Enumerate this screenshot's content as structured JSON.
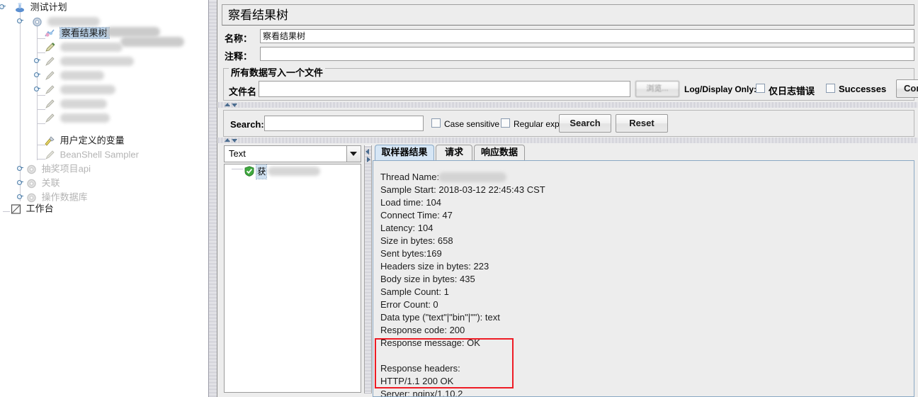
{
  "tree": {
    "nodes": [
      {
        "label": "测试计划",
        "icon": "test-plan-icon",
        "blurred": false,
        "selected": false,
        "depth": 0
      },
      {
        "label": "",
        "icon": "thread-group-icon",
        "blurred": true,
        "blur_width": 74,
        "selected": false,
        "depth": 1
      },
      {
        "label": "察看结果树",
        "icon": "view-results-tree-icon",
        "blurred": false,
        "selected": true,
        "depth": 2
      },
      {
        "label": "",
        "icon": "pencil-icon",
        "blurred": true,
        "blur_width": 88,
        "selected": false,
        "depth": 2
      },
      {
        "label": "",
        "icon": "sampler-icon",
        "blurred": true,
        "blur_width": 104,
        "selected": false,
        "depth": 2
      },
      {
        "label": "",
        "icon": "sampler-icon",
        "blurred": true,
        "blur_width": 62,
        "selected": false,
        "depth": 2
      },
      {
        "label": "",
        "icon": "sampler-icon",
        "blurred": true,
        "blur_width": 78,
        "selected": false,
        "depth": 2
      },
      {
        "label": "",
        "icon": "sampler-icon",
        "blurred": true,
        "blur_width": 66,
        "selected": false,
        "depth": 2
      },
      {
        "label": "用户定义的变量",
        "icon": "user-defined-variables-icon",
        "blurred": false,
        "selected": false,
        "depth": 2
      },
      {
        "label": "BeanShell Sampler",
        "icon": "beanshell-icon",
        "blurred": false,
        "selected": false,
        "depth": 2,
        "dim": true
      },
      {
        "label": "抽奖项目api",
        "icon": "thread-group-icon",
        "blurred": false,
        "selected": false,
        "depth": 1,
        "dim": true
      },
      {
        "label": "关联",
        "icon": "thread-group-icon",
        "blurred": false,
        "selected": false,
        "depth": 1,
        "dim": true
      },
      {
        "label": "操作数据库",
        "icon": "thread-group-icon",
        "blurred": false,
        "selected": false,
        "depth": 1,
        "dim": true
      },
      {
        "label": "工作台",
        "icon": "workbench-icon",
        "blurred": false,
        "selected": false,
        "depth": 0
      }
    ]
  },
  "panel": {
    "title": "察看结果树",
    "name_label": "名称：",
    "name_value": "察看结果树",
    "comment_label": "注释：",
    "comment_value": "",
    "filegroup_title": "所有数据写入一个文件",
    "filename_label": "文件名",
    "filename_value": "",
    "filename_placeholder": "",
    "browse_button": "浏览...",
    "log_display_only_label": "Log/Display Only:",
    "errors_only_checkbox": "仅日志错误",
    "errors_only_checked": false,
    "successes_checkbox": "Successes",
    "successes_checked": false,
    "configure_button": "Confi"
  },
  "search": {
    "label": "Search:",
    "value": "",
    "case_sensitive_label": "Case sensitive",
    "case_sensitive_checked": false,
    "regular_exp_label": "Regular exp.",
    "regular_exp_checked": false,
    "search_button": "Search",
    "reset_button": "Reset"
  },
  "results": {
    "renderer_selected": "Text",
    "renderer_options": [
      "Text"
    ],
    "tree_item_label": "获",
    "tabs": [
      {
        "label": "取样器结果",
        "active": true
      },
      {
        "label": "请求",
        "active": false
      },
      {
        "label": "响应数据",
        "active": false
      }
    ],
    "detail_lines": [
      "Thread Name:",
      "Sample Start: 2018-03-12 22:45:43 CST",
      "Load time: 104",
      "Connect Time: 47",
      "Latency: 104",
      "Size in bytes: 658",
      "Sent bytes:169",
      "Headers size in bytes: 223",
      "Body size in bytes: 435",
      "Sample Count: 1",
      "Error Count: 0",
      "Data type (\"text\"|\"bin\"|\"\"): text",
      "Response code: 200",
      "Response message: OK",
      "",
      "Response headers:",
      "HTTP/1.1 200 OK",
      "Server: nginx/1.10.2"
    ]
  },
  "colors": {
    "accent": "#d6e6f5",
    "selection": "#b8cfe5",
    "annotation": "#ee1c25",
    "panel_bg": "#ededed",
    "success": "#3faa3f"
  }
}
